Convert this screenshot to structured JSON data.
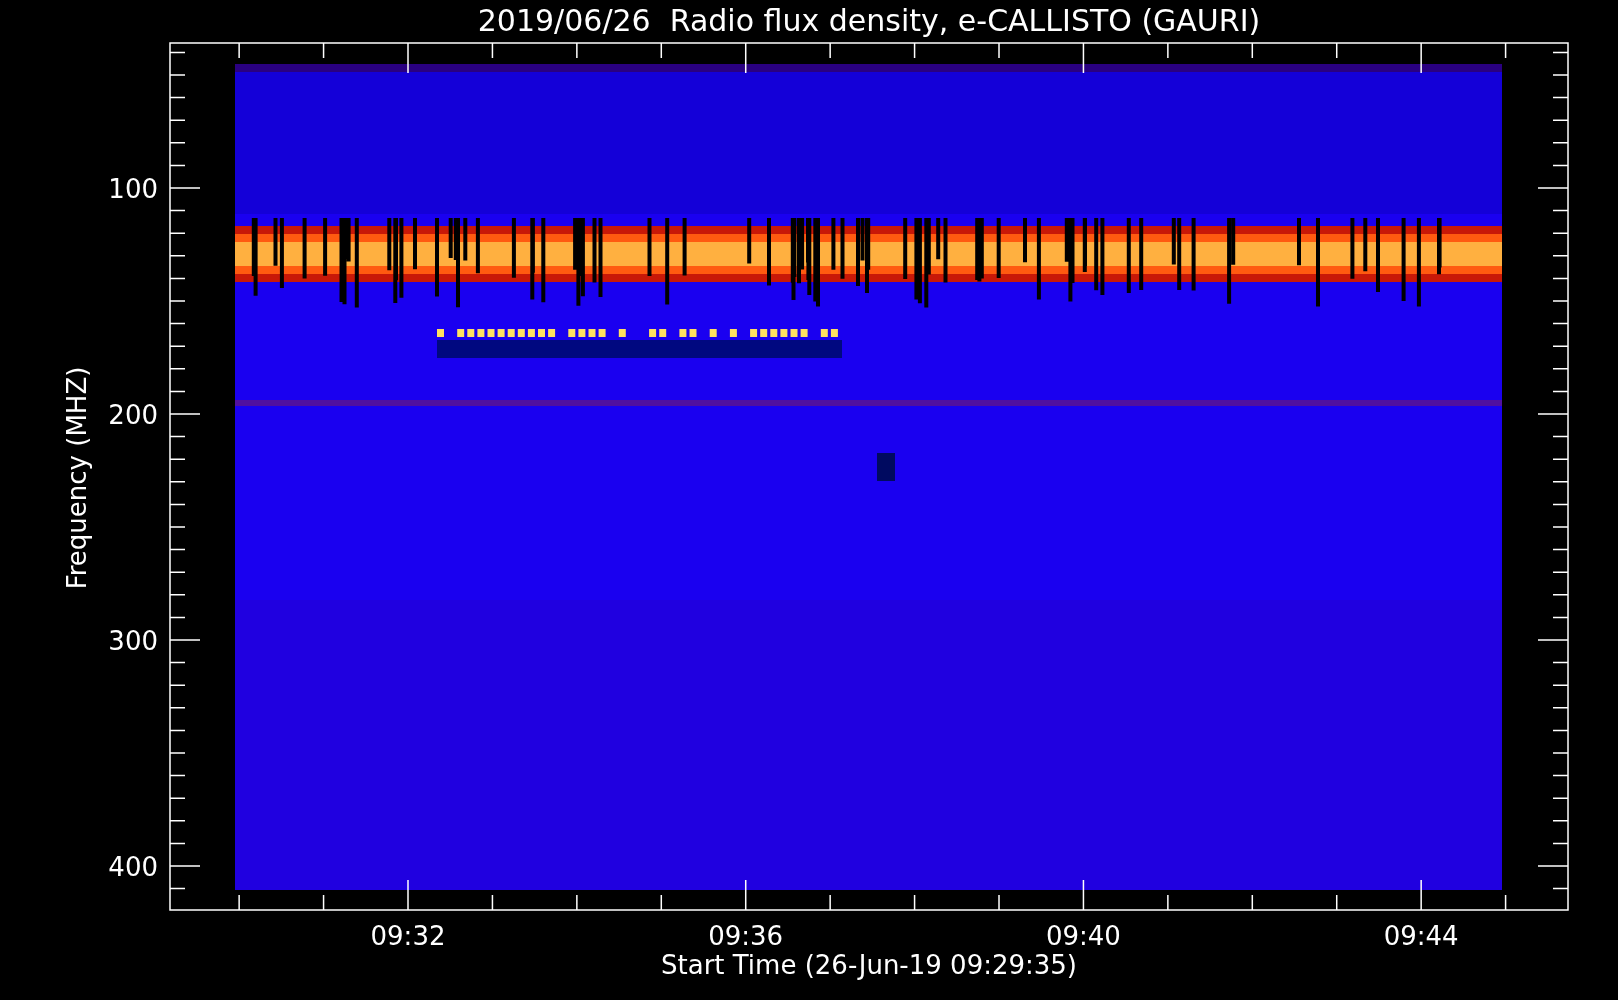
{
  "title": "2019/06/26  Radio flux density, e-CALLISTO (GAURI)",
  "y_axis": {
    "label": "Frequency (MHZ)",
    "ticks": [
      "100",
      "200",
      "300",
      "400"
    ]
  },
  "x_axis": {
    "label": "Start Time (26-Jun-19 09:29:35)",
    "ticks": [
      "09:32",
      "09:36",
      "09:40",
      "09:44"
    ]
  }
}
